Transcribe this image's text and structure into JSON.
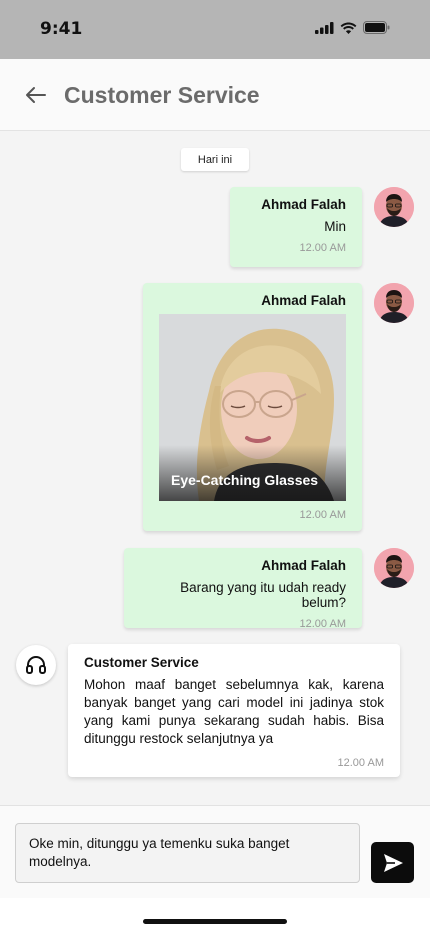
{
  "status_bar": {
    "time": "9:41"
  },
  "header": {
    "title": "Customer Service"
  },
  "date_chip": "Hari ini",
  "messages": [
    {
      "sender": "Ahmad Falah",
      "text": "Min",
      "time": "12.00 AM"
    },
    {
      "sender": "Ahmad Falah",
      "image_caption": "Eye-Catching Glasses",
      "time": "12.00 AM"
    },
    {
      "sender": "Ahmad Falah",
      "text": "Barang yang itu udah ready belum?",
      "time": "12.00 AM"
    },
    {
      "sender": "Customer Service",
      "text": "Mohon maaf banget sebelumnya kak, karena banyak banget yang cari model ini jadinya stok yang kami punya sekarang sudah habis. Bisa ditunggu restock selanjutnya ya",
      "time": "12.00 AM"
    }
  ],
  "composer": {
    "value": "Oke min, ditunggu ya temenku suka banget modelnya."
  },
  "colors": {
    "outgoing_bubble": "#dbf8de",
    "avatar_bg": "#f2a4ae",
    "send_button": "#0c0c0c"
  },
  "icons": [
    "back-arrow-icon",
    "headset-icon",
    "send-icon",
    "signal-icon",
    "wifi-icon",
    "battery-icon"
  ]
}
